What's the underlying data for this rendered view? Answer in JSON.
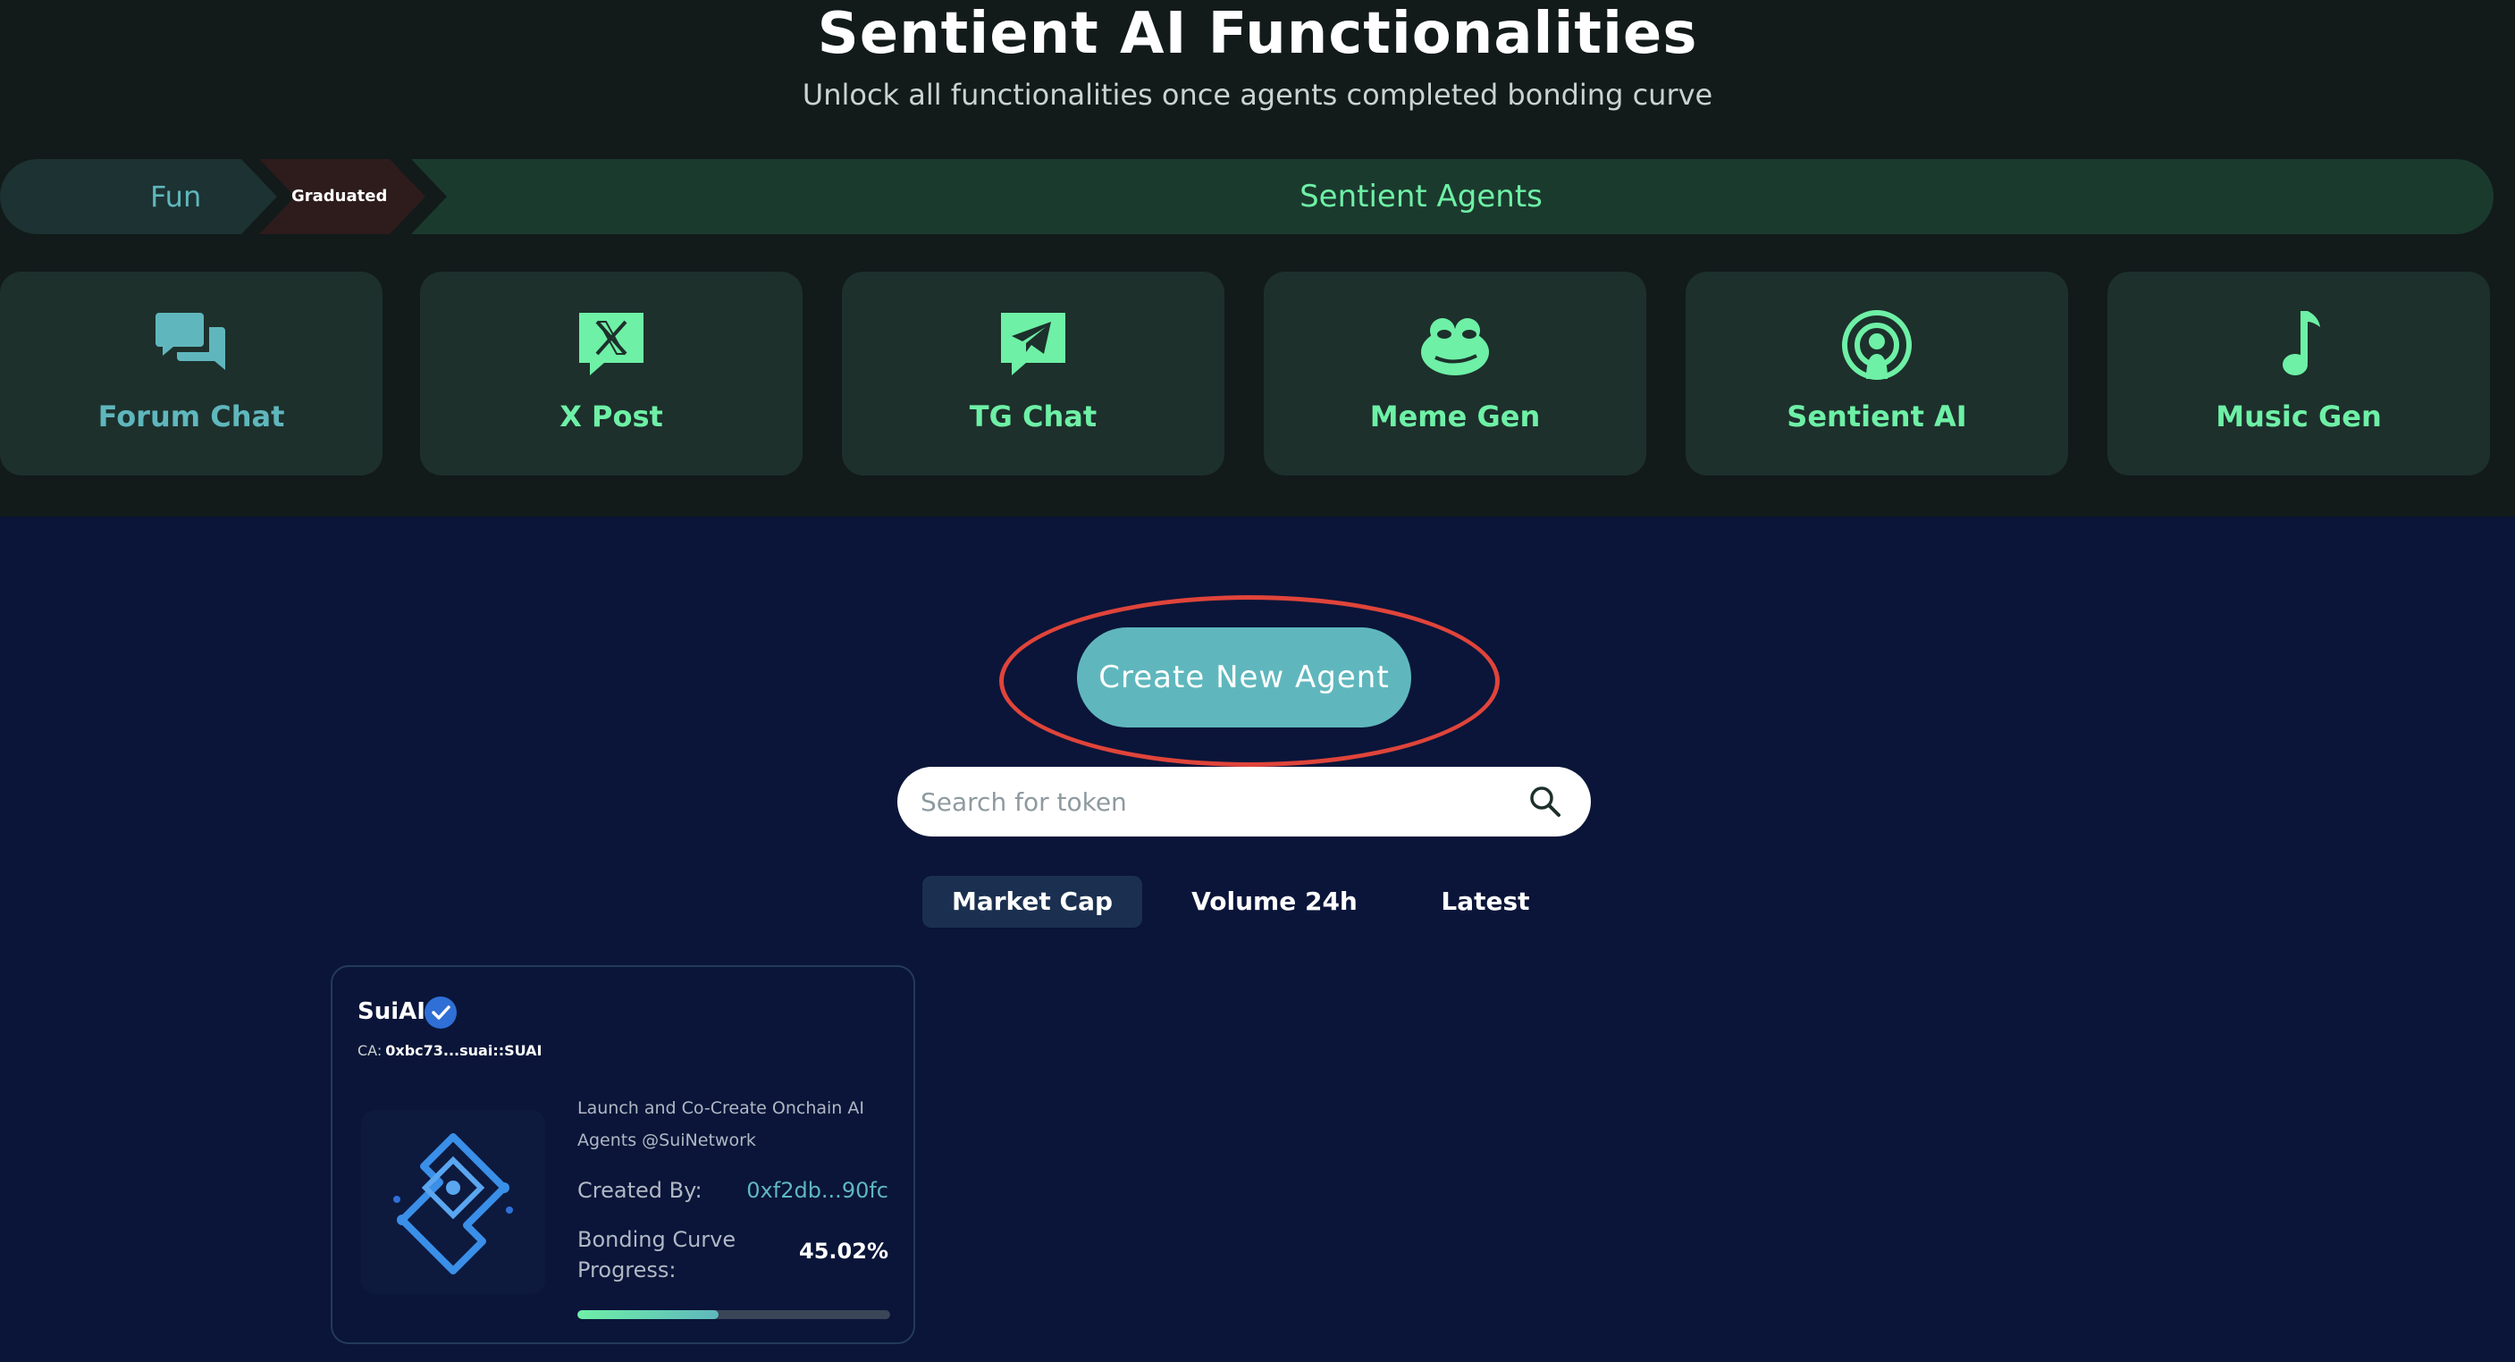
{
  "header": {
    "title": "Sentient AI Functionalities",
    "subtitle": "Unlock all functionalities once agents completed bonding curve"
  },
  "tabs": {
    "fun": "Fun",
    "graduated": "Graduated",
    "sentient": "Sentient Agents"
  },
  "features": [
    {
      "label": "Forum Chat",
      "icon": "forum-chat-icon"
    },
    {
      "label": "X Post",
      "icon": "x-logo-icon"
    },
    {
      "label": "TG Chat",
      "icon": "telegram-icon"
    },
    {
      "label": "Meme Gen",
      "icon": "pepe-frog-icon"
    },
    {
      "label": "Sentient AI",
      "icon": "podcast-broadcast-icon"
    },
    {
      "label": "Music Gen",
      "icon": "music-note-icon"
    }
  ],
  "create_button": "Create New Agent",
  "search": {
    "placeholder": "Search for token"
  },
  "sort_tabs": [
    {
      "label": "Market Cap",
      "active": true
    },
    {
      "label": "Volume 24h",
      "active": false
    },
    {
      "label": "Latest",
      "active": false
    }
  ],
  "token": {
    "name": "SuiAI",
    "ca_label": "CA:",
    "ca_value": "0xbc73...suai::SUAI",
    "description": "Launch and Co-Create Onchain AI Agents @SuiNetwork",
    "created_label": "Created By:",
    "created_value": "0xf2db...90fc",
    "bonding_label": "Bonding Curve Progress:",
    "bonding_value": "45.02%",
    "bonding_fraction": 0.4502
  },
  "colors": {
    "accent_green": "#6ef0a6",
    "accent_teal": "#5fb7bd",
    "highlight_red": "#e0443a",
    "page_bg": "#0a1539",
    "top_bg": "#121a1a"
  }
}
